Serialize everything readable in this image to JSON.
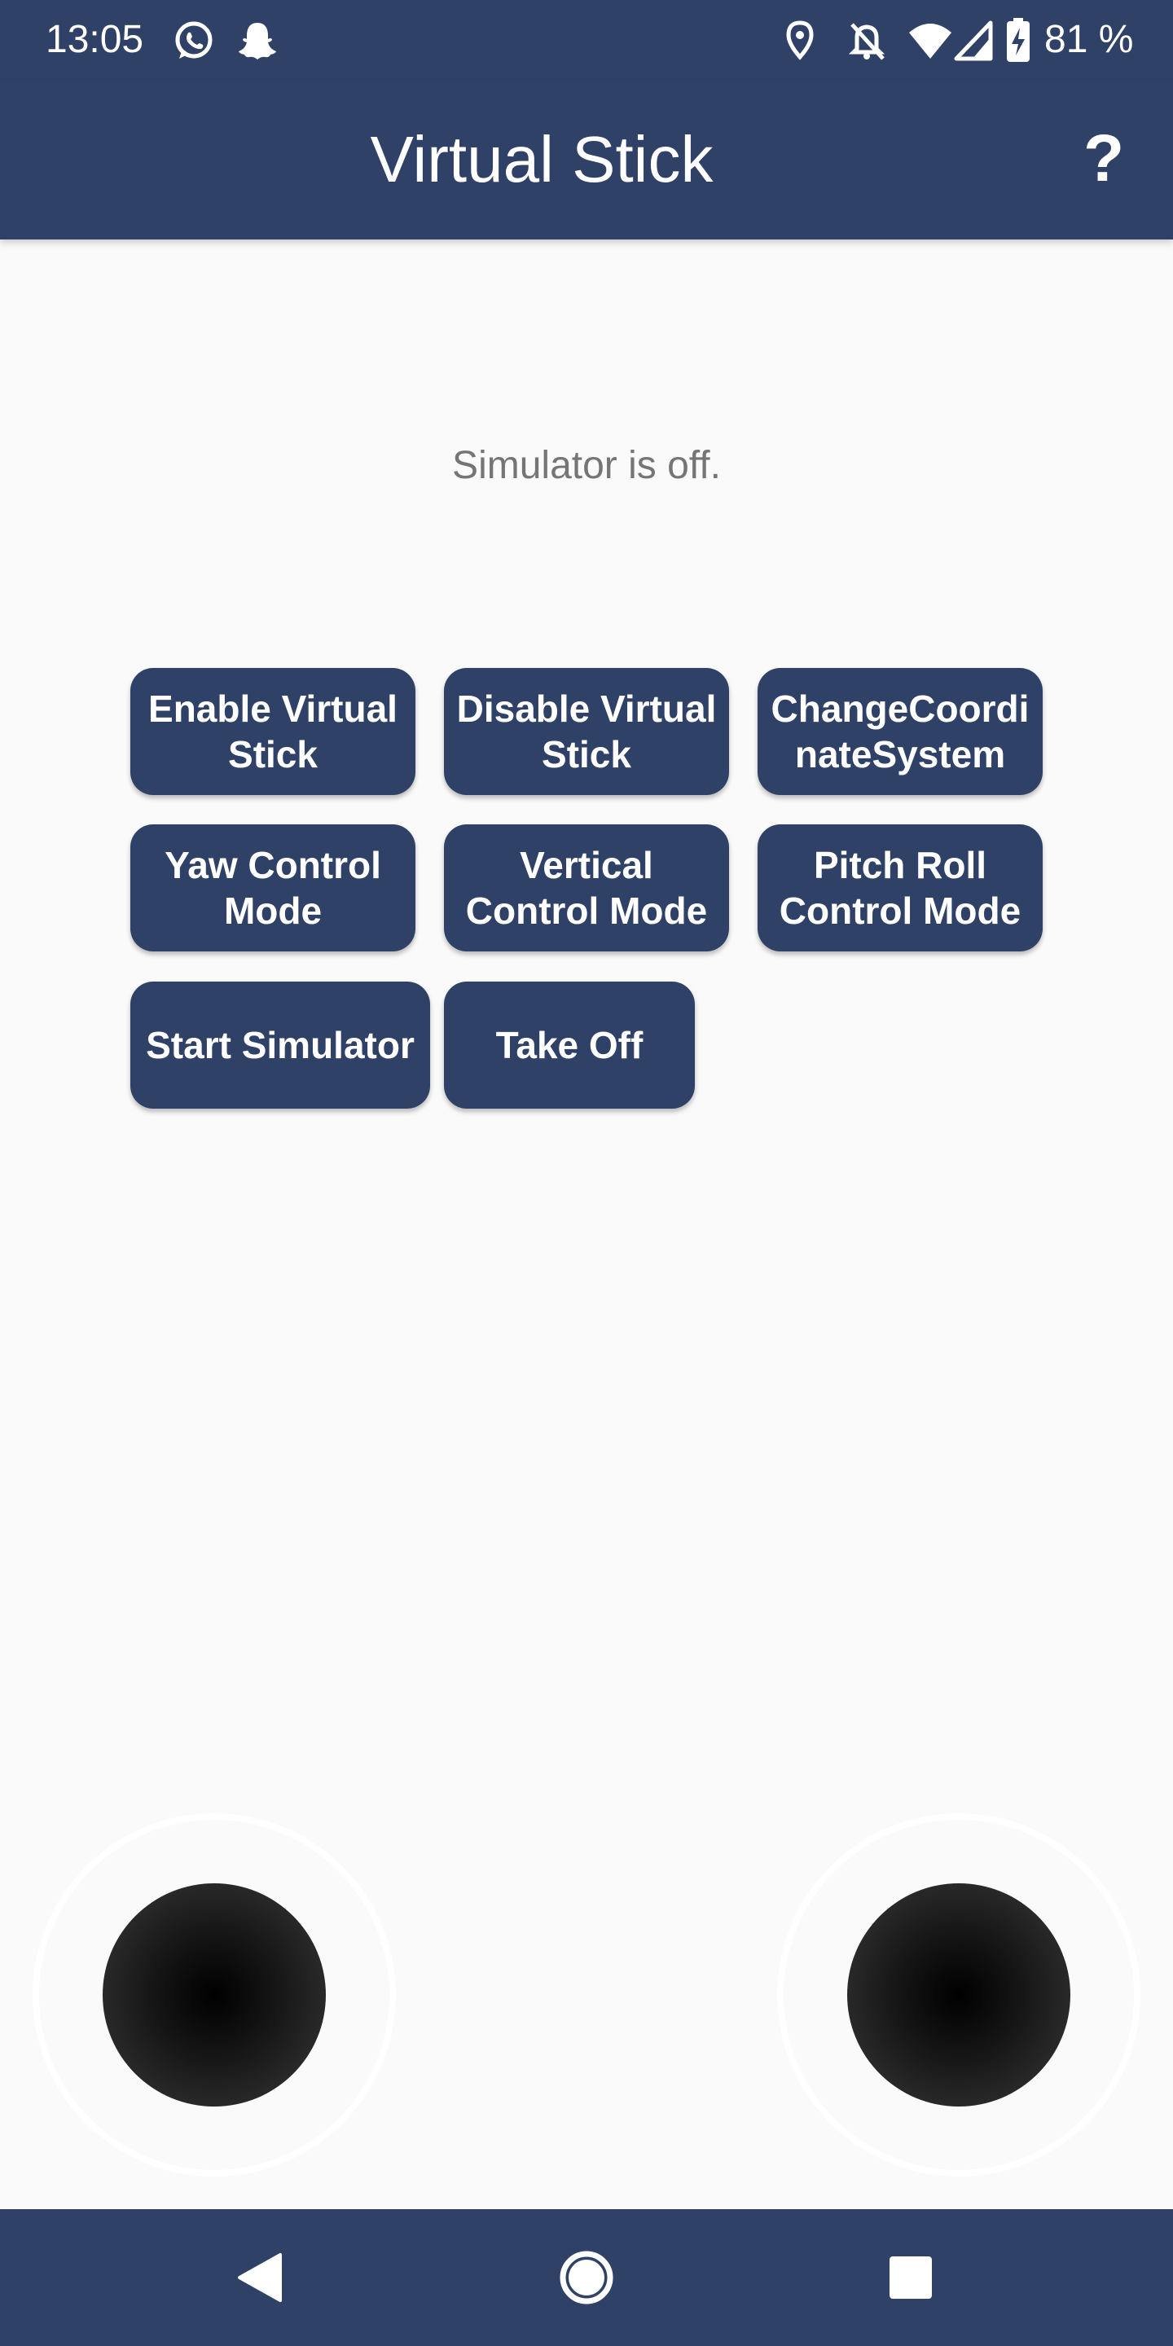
{
  "status_bar": {
    "time": "13:05",
    "left_icons": [
      "whatsapp-icon",
      "snapchat-icon"
    ],
    "right_icons": [
      "location-icon",
      "notifications-off-icon",
      "wifi-icon",
      "cell-signal-icon",
      "battery-charging-icon"
    ],
    "battery": "81 %"
  },
  "app_bar": {
    "title": "Virtual Stick",
    "help_label": "?",
    "background": "#304167"
  },
  "simulator_status": "Simulator is off.",
  "buttons": {
    "enable_virtual_stick": "Enable Virtual Stick",
    "disable_virtual_stick": "Disable Virtual Stick",
    "change_coordinate_system": "ChangeCoordinateSystem",
    "yaw_control_mode": "Yaw Control Mode",
    "vertical_control_mode": "Vertical Control Mode",
    "pitch_roll_control_mode": "Pitch Roll Control Mode",
    "start_simulator": "Start Simulator",
    "take_off": "Take Off"
  },
  "joysticks": [
    "left-joystick",
    "right-joystick"
  ],
  "nav_bar": {
    "icons": [
      "back-icon",
      "home-icon",
      "recents-icon"
    ]
  },
  "colors": {
    "primary": "#304167",
    "background": "#fafafa",
    "status_text": "#757575"
  }
}
